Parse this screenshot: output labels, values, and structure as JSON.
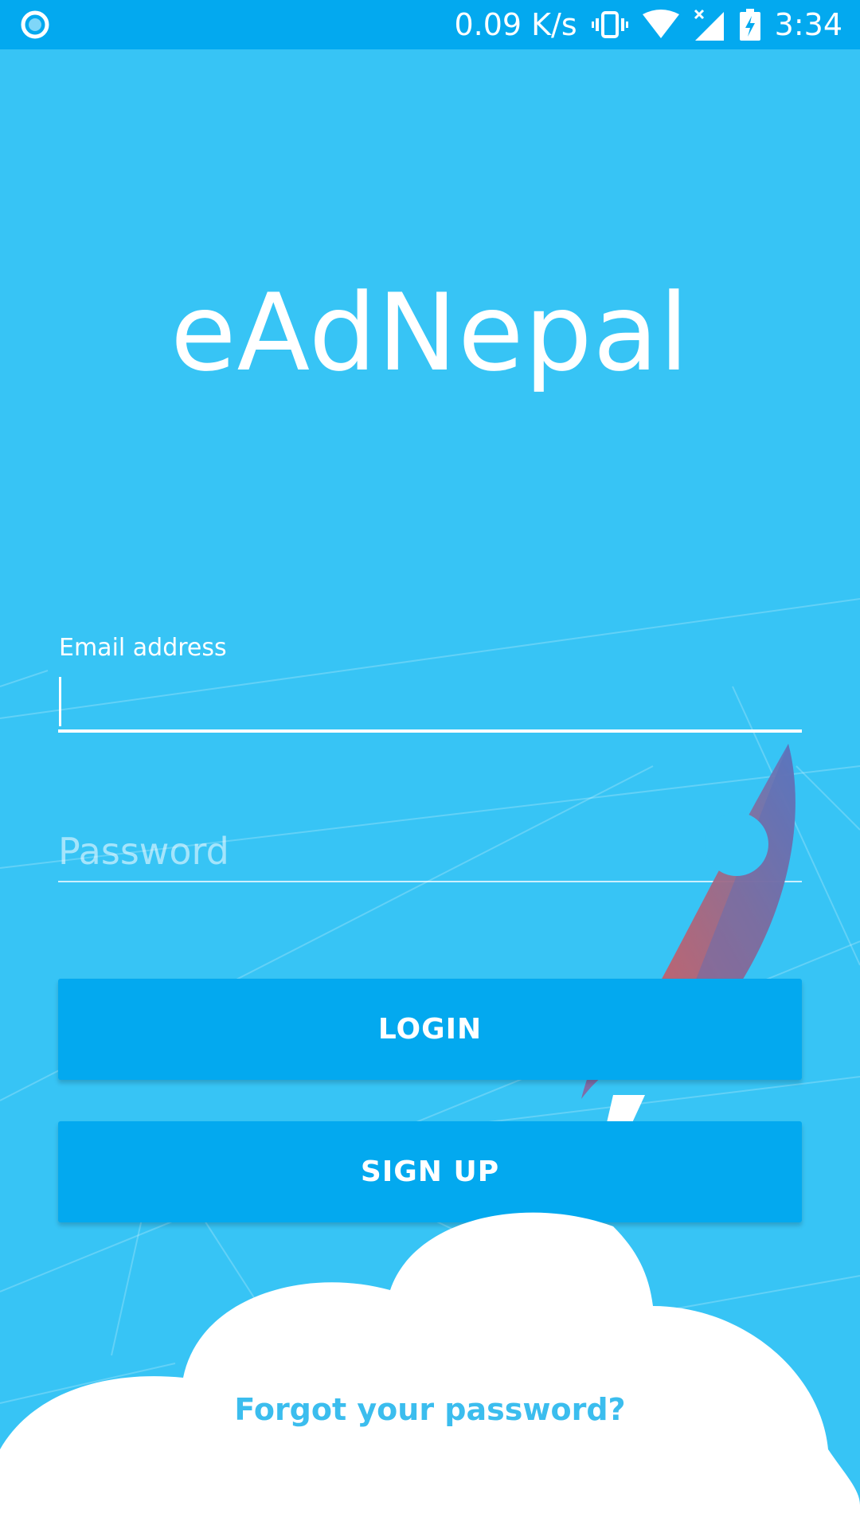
{
  "status_bar": {
    "network_speed": "0.09 K/s",
    "time": "3:34",
    "icons": [
      "notification-icon",
      "vibrate-icon",
      "wifi-icon",
      "cellular-signal-icon",
      "battery-charging-icon"
    ]
  },
  "app": {
    "title": "eAdNepal"
  },
  "login_form": {
    "email_label": "Email address",
    "email_value": "",
    "password_placeholder": "Password",
    "login_label": "LOGIN",
    "signup_label": "SIGN UP",
    "forgot_password_label": "Forgot your password?"
  },
  "colors": {
    "background": "#37c4f5",
    "accent": "#03a9ef",
    "link": "#3bbdee",
    "text": "#ffffff"
  }
}
